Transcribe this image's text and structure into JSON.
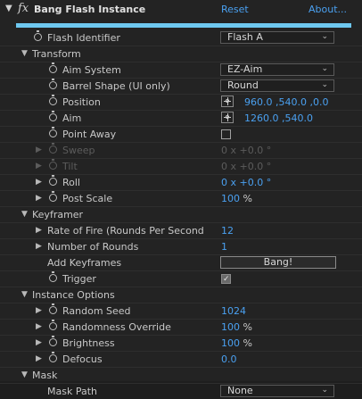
{
  "header": {
    "fx": "fx",
    "title": "Bang Flash Instance",
    "reset": "Reset",
    "about": "About..."
  },
  "flash_identifier": {
    "label": "Flash Identifier",
    "value": "Flash A"
  },
  "transform": {
    "title": "Transform",
    "aim_system": {
      "label": "Aim System",
      "value": "EZ-Aim"
    },
    "barrel_shape": {
      "label": "Barrel Shape (UI only)",
      "value": "Round"
    },
    "position": {
      "label": "Position",
      "value": "960.0 ,540.0 ,0.0"
    },
    "aim": {
      "label": "Aim",
      "value": "1260.0 ,540.0"
    },
    "point_away": {
      "label": "Point Away",
      "checked": false
    },
    "sweep": {
      "label": "Sweep",
      "value": "0 x +0.0 °"
    },
    "tilt": {
      "label": "Tilt",
      "value": "0 x +0.0 °"
    },
    "roll": {
      "label": "Roll",
      "value": "0 x +0.0 °"
    },
    "post_scale": {
      "label": "Post Scale",
      "value": "100",
      "unit": "%"
    }
  },
  "keyframer": {
    "title": "Keyframer",
    "rate_of_fire": {
      "label": "Rate of Fire (Rounds Per Second",
      "value": "12"
    },
    "number_of_rounds": {
      "label": "Number of Rounds",
      "value": "1"
    },
    "add_keyframes": {
      "label": "Add Keyframes",
      "button": "Bang!"
    },
    "trigger": {
      "label": "Trigger",
      "checked": true
    }
  },
  "instance_options": {
    "title": "Instance Options",
    "random_seed": {
      "label": "Random Seed",
      "value": "1024"
    },
    "randomness_override": {
      "label": "Randomness Override",
      "value": "100",
      "unit": "%"
    },
    "brightness": {
      "label": "Brightness",
      "value": "100",
      "unit": "%"
    },
    "defocus": {
      "label": "Defocus",
      "value": "0.0"
    }
  },
  "mask": {
    "title": "Mask",
    "mask_path": {
      "label": "Mask Path",
      "value": "None"
    }
  }
}
